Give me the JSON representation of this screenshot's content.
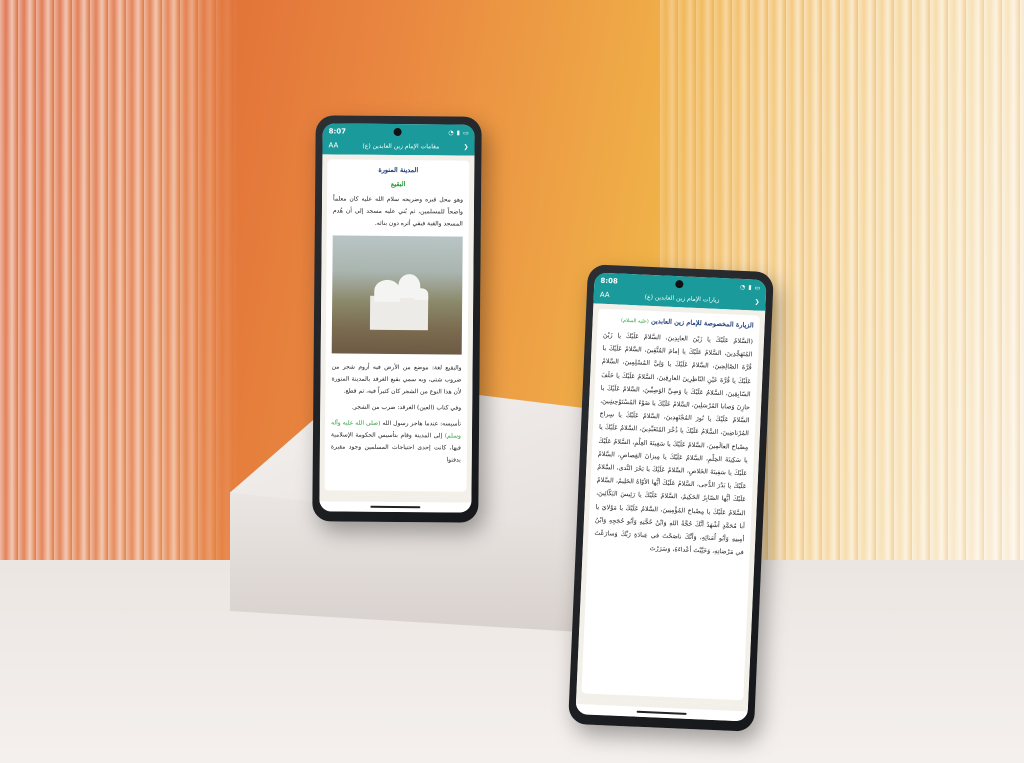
{
  "phone1": {
    "time": "8:07",
    "title": "مقامات الإمام زين العابدين (ع)",
    "font_size_label": "AA",
    "heading_city": "المدينة المنورة",
    "heading_place": "البقيع",
    "intro_text": "وهو محل قبره وضريحه سلام الله عليه كان معلماً واضحاً للمسلمين، ثم بُني عليه مسجد إلى أن هُدم المسجد والقبة فبقي أثره دون بنائه.",
    "paragraph_1": "والبقيع لغة: موضع من الأرض فيه أروم شجر من ضروب شتى، وبه سمي بقيع الغرقد بالمدينة المنورة لأن هذا النوع من الشجر كان كثيراً فيه، ثم قطع.",
    "paragraph_2": "وفي كتاب (العين) الغرقد: ضرب من الشجر.",
    "paragraph_3a": "تأسيسه: عندما هاجر رسول الله",
    "paragraph_3_honorific": "(صلى الله عليه وآله وسلم)",
    "paragraph_3b": "إلى المدينة وقام بتأسيس الحكومة الإسلامية فيها، كانت إحدى احتياجات المسلمين وجود مقبرة يدفنوا"
  },
  "phone2": {
    "time": "8:08",
    "title": "زيارات الإمام زين العابدين (ع)",
    "font_size_label": "AA",
    "heading": "الزيارة المخصوصة للإمام زين العابدين",
    "heading_suffix": "(عليه السلام)",
    "body": "(السَّلامُ عَلَيْكَ يا زَيْنَ العابِدِينَ، السَّلامُ عَلَيْكَ يا زَيْنَ المُتَهَجِّدِينَ، السَّلامُ عَلَيْكَ يا إمامَ المُتَّقِينَ، السَّلامُ عَلَيْكَ يا قُرَّةَ الصّالِحِينَ، السَّلامُ عَلَيْكَ يا وَلِيَّ المُسْلِمِينَ، السَّلامُ عَلَيْكَ يا قُرَّةَ عَيْنِ النّاظِرِينَ العارِفِينَ، السَّلامُ عَلَيْكَ يا خَلَفَ السّابِقِينَ، السَّلامُ عَلَيْكَ يا وَصِيَّ الوَصِيِّينَ، السَّلامُ عَلَيْكَ يا خازِنَ وَصايا المُرْسَلِينَ، السَّلامُ عَلَيْكَ يا ضَوْءَ المُسْتَوْحِشِينَ، السَّلامُ عَلَيْكَ يا نُورَ المُجْتَهِدِينَ، السَّلامُ عَلَيْكَ يا سِراجَ المُرْتاضِينَ، السَّلامُ عَلَيْكَ يا ذُخْرَ المُتَعَبِّدِينَ، السَّلامُ عَلَيْكَ يا مِصْباحَ العالَمِينَ، السَّلامُ عَلَيْكَ يا سَفِينَةَ العِلْمِ، السَّلامُ عَلَيْكَ يا سَكِينَةَ الحِلْمِ، السَّلامُ عَلَيْكَ يا مِيزانَ القِصاصِ، السَّلامُ عَلَيْكَ يا سَفِينَةَ الخَلاصِ، السَّلامُ عَلَيْكَ يا بَحْرَ النَّدى، السَّلامُ عَلَيْكَ يا بَدْرَ الدُّجى، السَّلامُ عَلَيْكَ أيُّها الأوّاهُ الحَلِيمُ، السَّلامُ عَلَيْكَ أيُّها الصّابِرُ الحَكِيمُ، السَّلامُ عَلَيْكَ يا رَئِيسَ البَكّائِينَ، السَّلامُ عَلَيْكَ يا مِصْباحَ المُؤْمِنِينَ، السَّلامُ عَلَيْكَ يا مَوْلايَ يا أبا مُحَمَّدٍ أشْهَدُ أنَّكَ حُجَّةُ اللهِ وَابْنُ حُجَّتِهِ وَأبُو حُجَجِهِ وَابْنُ أمِينِهِ وَأبُو اُمَنائِهِ، وَأنَّكَ ناصَحْتَ في عِبادَةِ رَبِّكَ وَسارَعْتَ في مَرْضاتِهِ، وَخَيَّبْتَ أعْداءَهُ، وَسَرَرْتَ"
  }
}
